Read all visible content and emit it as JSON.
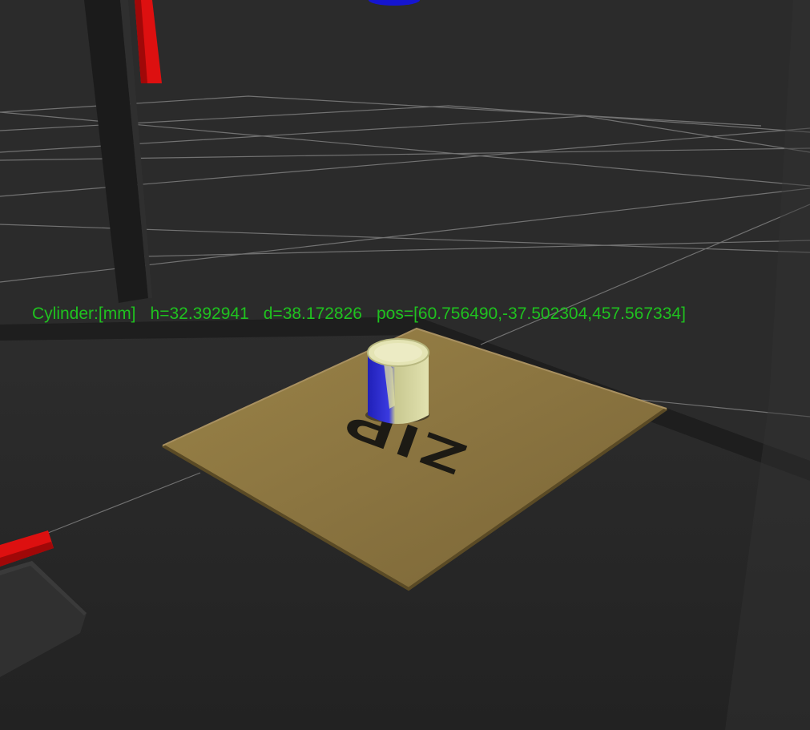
{
  "overlay": {
    "shape_label": "Cylinder:[mm]",
    "height_text": "h=32.392941",
    "diameter_text": "d=38.172826",
    "position_text": "pos=[60.756490,-37.502304,457.567334]"
  },
  "carton": {
    "print_text": "ZIP"
  },
  "colors": {
    "background": "#2b2b2b",
    "overlay_text": "#1fc21f",
    "axis_x": "#dd1010",
    "axis_z": "#1010cc",
    "cardboard": "#8a7440",
    "cylinder_top": "#dcdca0",
    "cylinder_blue": "#2a2ad0"
  }
}
